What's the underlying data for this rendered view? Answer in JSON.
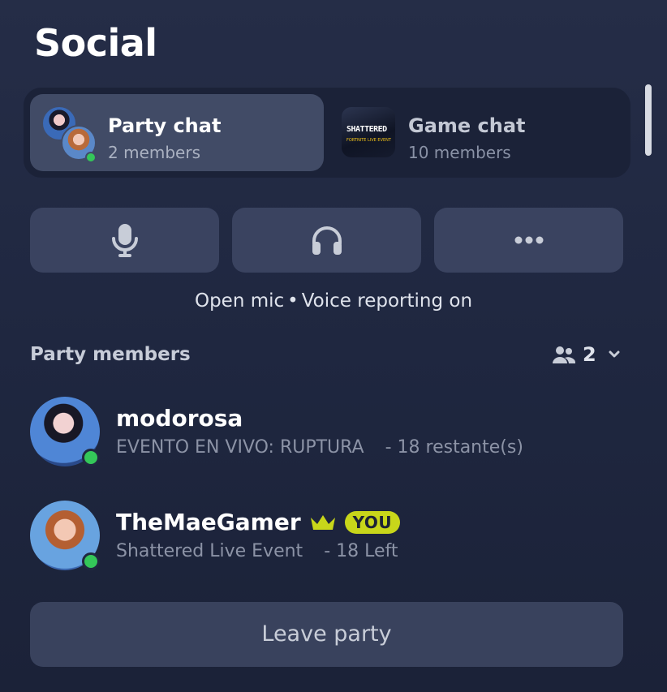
{
  "header": {
    "title": "Social"
  },
  "tabs": [
    {
      "title": "Party chat",
      "subtitle": "2 members",
      "active": true
    },
    {
      "title": "Game chat",
      "subtitle": "10 members",
      "active": false,
      "thumb_text": "SHATTERED",
      "thumb_sub": "FORTNITE LIVE EVENT"
    }
  ],
  "controls": [
    {
      "icon": "microphone-icon"
    },
    {
      "icon": "headphones-icon"
    },
    {
      "icon": "more-dots-icon"
    }
  ],
  "voice_status": {
    "mode": "Open mic",
    "separator": "•",
    "reporting": "Voice reporting on"
  },
  "members": {
    "header": "Party members",
    "count": "2",
    "list": [
      {
        "name": "modorosa",
        "activity": "EVENTO EN VIVO: RUPTURA",
        "remaining": "- 18 restante(s)",
        "online": true,
        "leader": false,
        "badge": ""
      },
      {
        "name": "TheMaeGamer",
        "activity": "Shattered Live Event",
        "remaining": "- 18 Left",
        "online": true,
        "leader": true,
        "badge": "YOU"
      }
    ]
  },
  "leave_button": {
    "label": "Leave party"
  },
  "colors": {
    "online": "#34c759",
    "crown": "#c8d61a",
    "you_badge": "#c8d61a"
  }
}
